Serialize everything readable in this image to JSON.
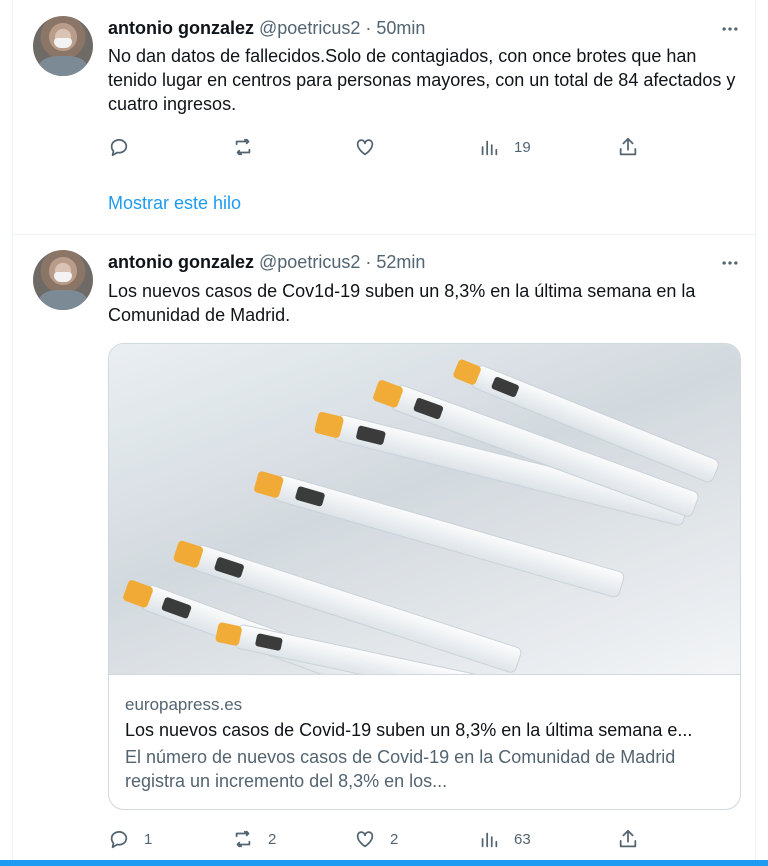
{
  "tweets": [
    {
      "author_name": "antonio gonzalez",
      "meta": "@poetricus2 · 50min",
      "text": "No dan datos de fallecidos.Solo de contagiados, con once brotes que han tenido lugar en centros para personas mayores, con un total de 84 afectados y cuatro ingresos.",
      "views": "19",
      "show_thread": "Mostrar este hilo"
    },
    {
      "author_name": "antonio gonzalez",
      "meta": "@poetricus2 · 52min",
      "text": "Los nuevos casos de Cov1d-19 suben un 8,3% en la última semana en la Comunidad de Madrid.",
      "card": {
        "domain": "europapress.es",
        "title": "Los nuevos casos de Covid-19 suben un 8,3% en la última semana e...",
        "description": "El número de nuevos casos de Covid-19 en la Comunidad de Madrid registra un incremento del 8,3% en los..."
      },
      "replies": "1",
      "retweets": "2",
      "likes": "2",
      "views": "63"
    }
  ],
  "icons": {
    "reply": "reply-icon",
    "retweet": "retweet-icon",
    "like": "heart-icon",
    "views": "views-icon",
    "share": "share-icon",
    "more": "more-icon"
  },
  "colors": {
    "accent": "#1d9bf0",
    "secondary_text": "#536471",
    "border": "#eff3f4"
  }
}
